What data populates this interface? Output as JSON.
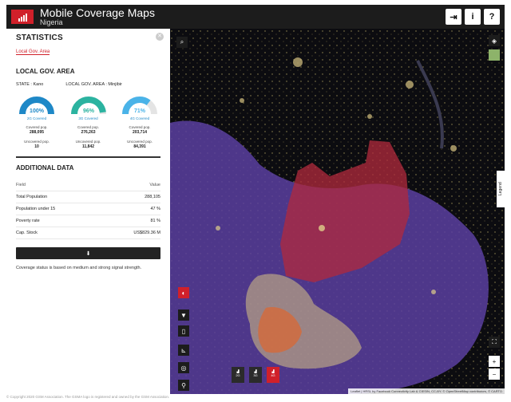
{
  "header": {
    "title": "Mobile Coverage Maps",
    "subtitle": "Nigeria",
    "buttons": [
      {
        "name": "exit-button",
        "glyph": "⇥"
      },
      {
        "name": "info-button",
        "glyph": "i"
      },
      {
        "name": "help-button",
        "glyph": "?"
      }
    ]
  },
  "panel": {
    "title": "STATISTICS",
    "close_glyph": "✕",
    "sub_tab": "Local Gov. Area",
    "section_title": "LOCAL GOV. AREA",
    "state": "STATE : Kano",
    "lga": "LOCAL GOV. AREA : Minjibir",
    "gauges": [
      {
        "pct": "100%",
        "fraction": 1.0,
        "color": "#1e88c7",
        "label": "2G Covered",
        "covered_label": "Covered pop.",
        "covered": "288,095",
        "uncovered_label": "Uncovered pop.",
        "uncovered": "10"
      },
      {
        "pct": "96%",
        "fraction": 0.96,
        "color": "#2bb3a0",
        "label": "3G Covered",
        "covered_label": "Covered pop.",
        "covered": "276,263",
        "uncovered_label": "Uncovered pop.",
        "uncovered": "11,842"
      },
      {
        "pct": "71%",
        "fraction": 0.71,
        "color": "#4ab3e8",
        "label": "4G Covered",
        "covered_label": "Covered pop.",
        "covered": "203,714",
        "uncovered_label": "Uncovered pop.",
        "uncovered": "84,391"
      }
    ],
    "additional_title": "ADDITIONAL DATA",
    "table_header": {
      "field": "Field",
      "value": "Value"
    },
    "rows": [
      {
        "field": "Total Population",
        "value": "288,105"
      },
      {
        "field": "Population under 15",
        "value": "47 %"
      },
      {
        "field": "Poverty rate",
        "value": "81 %"
      },
      {
        "field": "Cap. Stock",
        "value": "US$829.36 M"
      }
    ],
    "download_glyph": "⬇",
    "note": "Coverage status is based on medium and strong signal strength."
  },
  "map": {
    "search_glyph": "⌕",
    "layers_glyph": "◈",
    "legend": "Legend",
    "fullscreen_glyph": "⛶",
    "zoom_in": "+",
    "zoom_out": "−",
    "controls": [
      {
        "name": "coverage-tool-button",
        "glyph": "◐"
      },
      {
        "name": "filter-button",
        "glyph": "▼"
      },
      {
        "name": "phone-button",
        "glyph": "▯"
      },
      {
        "name": "measure-button",
        "glyph": "⊾"
      },
      {
        "name": "locate-button",
        "glyph": "◎"
      },
      {
        "name": "marker-button",
        "glyph": "⚲"
      }
    ],
    "networks": [
      {
        "label": "2G",
        "active": false
      },
      {
        "label": "3G",
        "active": false
      },
      {
        "label": "4G",
        "active": true
      }
    ],
    "attribution": "Leaflet | HRSL by Facebook Connectivity Lab & CIESIN, CC-BY; © OpenStreetMap contributors, © CARTO"
  },
  "footer": {
    "copyright": "© Copyright 2020 GSM Association. The GSMA logo is registered and owned by the GSM Association."
  },
  "colors": {
    "accent": "#d0202a",
    "coverage": "#5a3fa0",
    "header": "#1c1c1c"
  }
}
